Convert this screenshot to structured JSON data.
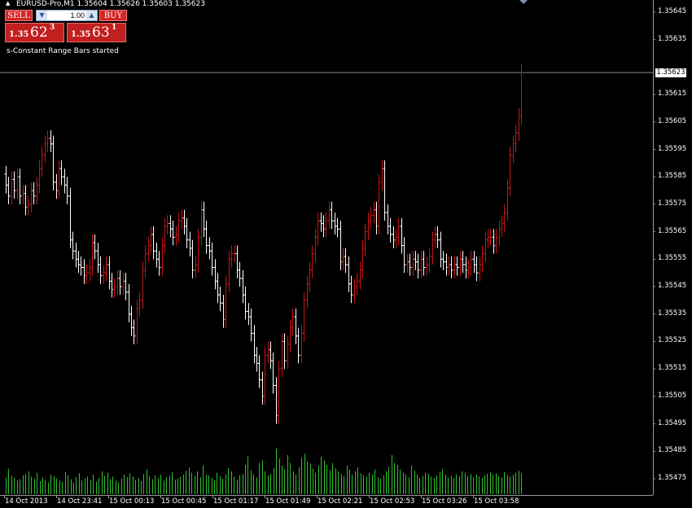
{
  "window": {
    "title": "EURUSD-Pro,M1  1.35604  1.35626  1.35603  1.35623",
    "status_message": "s-Constant Range Bars started"
  },
  "trade_panel": {
    "sell_label": "SELL",
    "buy_label": "BUY",
    "lot_value": "1.00",
    "sell_price_prefix": "1.35",
    "sell_price_big": "62",
    "sell_price_sup": "3",
    "buy_price_prefix": "1.35",
    "buy_price_big": "63",
    "buy_price_sup": "1"
  },
  "price_axis": {
    "labels": [
      "1.35645",
      "1.35635",
      "1.35615",
      "1.35605",
      "1.35595",
      "1.35585",
      "1.35575",
      "1.35565",
      "1.35555",
      "1.35545",
      "1.35535",
      "1.35525",
      "1.35515",
      "1.35505",
      "1.35495",
      "1.35485",
      "1.35475"
    ],
    "current_price": "1.35623"
  },
  "time_axis": {
    "labels": [
      "14 Oct 2013",
      "14 Oct 23:41",
      "15 Oct 00:13",
      "15 Oct 00:45",
      "15 Oct 01:17",
      "15 Oct 01:49",
      "15 Oct 02:21",
      "15 Oct 02:53",
      "15 Oct 03:26",
      "15 Oct 03:58"
    ]
  },
  "colors": {
    "background": "#000000",
    "bull_bar": "#c81414",
    "bear_bar": "#ffffff",
    "volume": "#2fbf2f",
    "price_line": "#8c8c8c",
    "axis": "#9a9a9a"
  },
  "chart_data": {
    "type": "bar",
    "instrument": "EURUSD-Pro",
    "timeframe": "M1",
    "ylim": [
      1.3547,
      1.3565
    ],
    "current_price": 1.35623,
    "close": [
      1.35582,
      1.35578,
      1.35584,
      1.3558,
      1.35585,
      1.35578,
      1.35579,
      1.35574,
      1.35575,
      1.3558,
      1.35578,
      1.35582,
      1.35588,
      1.35593,
      1.35597,
      1.35599,
      1.35597,
      1.35583,
      1.3558,
      1.35588,
      1.35585,
      1.35582,
      1.35578,
      1.35562,
      1.35558,
      1.35555,
      1.35553,
      1.35552,
      1.35549,
      1.3555,
      1.35552,
      1.35561,
      1.35558,
      1.35553,
      1.35549,
      1.3555,
      1.35553,
      1.35547,
      1.35544,
      1.35545,
      1.35548,
      1.35545,
      1.35547,
      1.35543,
      1.35535,
      1.3553,
      1.35527,
      1.35537,
      1.3554,
      1.35551,
      1.35557,
      1.3556,
      1.35564,
      1.35558,
      1.35555,
      1.35552,
      1.3556,
      1.35567,
      1.35568,
      1.35566,
      1.35563,
      1.35564,
      1.35569,
      1.3557,
      1.35567,
      1.35562,
      1.35559,
      1.35551,
      1.35553,
      1.35563,
      1.35573,
      1.35566,
      1.3556,
      1.35558,
      1.35552,
      1.35547,
      1.35542,
      1.35539,
      1.35533,
      1.35546,
      1.35555,
      1.35557,
      1.35557,
      1.35551,
      1.35548,
      1.35542,
      1.35536,
      1.35534,
      1.35528,
      1.3552,
      1.35517,
      1.35511,
      1.35505,
      1.3552,
      1.35522,
      1.35518,
      1.35509,
      1.35498,
      1.35515,
      1.35525,
      1.35518,
      1.35524,
      1.3553,
      1.35534,
      1.35527,
      1.3552,
      1.35528,
      1.3554,
      1.35546,
      1.35551,
      1.35557,
      1.35563,
      1.35569,
      1.35568,
      1.35566,
      1.35569,
      1.35573,
      1.35569,
      1.35567,
      1.35566,
      1.35554,
      1.35556,
      1.35553,
      1.35546,
      1.35542,
      1.35545,
      1.35547,
      1.35551,
      1.35559,
      1.35565,
      1.35569,
      1.35571,
      1.35573,
      1.35567,
      1.35583,
      1.35588,
      1.35572,
      1.35567,
      1.35564,
      1.35562,
      1.35563,
      1.35567,
      1.3556,
      1.35553,
      1.35554,
      1.35552,
      1.35555,
      1.35554,
      1.35551,
      1.35555,
      1.35552,
      1.35553,
      1.35556,
      1.35562,
      1.35564,
      1.35562,
      1.35555,
      1.35554,
      1.35552,
      1.35553,
      1.35551,
      1.35553,
      1.35552,
      1.35555,
      1.35553,
      1.35551,
      1.35552,
      1.35555,
      1.35553,
      1.3555,
      1.35553,
      1.35557,
      1.35562,
      1.35563,
      1.35563,
      1.3556,
      1.35563,
      1.35566,
      1.35568,
      1.35572,
      1.35581,
      1.35593,
      1.35597,
      1.35601,
      1.35607,
      1.35623
    ],
    "volume_scale_max": 100,
    "volume": [
      26,
      39,
      28,
      25,
      21,
      23,
      29,
      31,
      35,
      27,
      24,
      33,
      20,
      26,
      22,
      18,
      30,
      28,
      24,
      21,
      19,
      34,
      29,
      23,
      18,
      26,
      32,
      21,
      24,
      27,
      22,
      30,
      19,
      25,
      35,
      28,
      33,
      23,
      27,
      21,
      18,
      24,
      30,
      26,
      32,
      27,
      22,
      25,
      20,
      31,
      38,
      27,
      23,
      29,
      25,
      30,
      21,
      26,
      28,
      34,
      22,
      24,
      27,
      30,
      36,
      41,
      33,
      28,
      35,
      26,
      44,
      30,
      29,
      25,
      21,
      33,
      28,
      24,
      30,
      40,
      35,
      27,
      22,
      29,
      31,
      45,
      58,
      37,
      30,
      26,
      48,
      52,
      35,
      29,
      31,
      40,
      70,
      55,
      44,
      38,
      60,
      48,
      35,
      30,
      41,
      56,
      62,
      50,
      47,
      39,
      33,
      44,
      58,
      52,
      45,
      37,
      48,
      40,
      35,
      31,
      28,
      44,
      38,
      30,
      35,
      41,
      32,
      29,
      27,
      33,
      30,
      38,
      26,
      24,
      29,
      35,
      42,
      60,
      48,
      45,
      38,
      33,
      30,
      26,
      44,
      36,
      30,
      25,
      28,
      33,
      31,
      27,
      25,
      29,
      34,
      38,
      30,
      26,
      28,
      25,
      30,
      27,
      35,
      33,
      28,
      31,
      26,
      30,
      27,
      25,
      29,
      31,
      33,
      30,
      32,
      28,
      26,
      34,
      29,
      27,
      30,
      33,
      36,
      32
    ]
  }
}
